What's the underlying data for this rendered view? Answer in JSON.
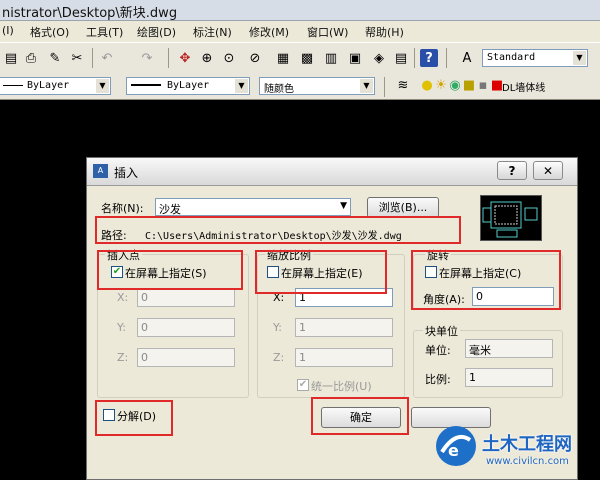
{
  "window": {
    "title": "nistrator\\Desktop\\新块.dwg"
  },
  "menu": [
    "(I)",
    "格式(O)",
    "工具(T)",
    "绘图(D)",
    "标注(N)",
    "修改(M)",
    "窗口(W)",
    "帮助(H)"
  ],
  "toolbar": {
    "style_combo": "Standard"
  },
  "properties": {
    "layer": "ByLayer",
    "linetype": "ByLayer",
    "color": "随颜色",
    "layer_name": "DL墙体线"
  },
  "dialog": {
    "title": "插入",
    "help_btn": "?",
    "close_btn": "✕",
    "name_label": "名称(N):",
    "name_value": "沙发",
    "browse_btn": "浏览(B)...",
    "path_label": "路径:",
    "path_value": "C:\\Users\\Administrator\\Desktop\\沙发\\沙发.dwg",
    "insertion": {
      "title": "插入点",
      "on_screen": "在屏幕上指定(S)",
      "checked": true,
      "x_label": "X:",
      "x": "0",
      "y_label": "Y:",
      "y": "0",
      "z_label": "Z:",
      "z": "0"
    },
    "scale": {
      "title": "缩放比例",
      "on_screen": "在屏幕上指定(E)",
      "checked": false,
      "x_label": "X:",
      "x": "1",
      "y_label": "Y:",
      "y": "1",
      "z_label": "Z:",
      "z": "1",
      "uniform": "统一比例(U)",
      "uniform_checked": true
    },
    "rotation": {
      "title": "旋转",
      "on_screen": "在屏幕上指定(C)",
      "checked": false,
      "angle_label": "角度(A):",
      "angle": "0"
    },
    "block_unit": {
      "title": "块单位",
      "unit_label": "单位:",
      "unit_value": "毫米",
      "ratio_label": "比例:",
      "ratio_value": "1"
    },
    "explode": "分解(D)",
    "explode_checked": false,
    "ok_btn": "确定"
  },
  "watermark": {
    "brand": "土木工程网",
    "url": "www.civilcn.com"
  }
}
